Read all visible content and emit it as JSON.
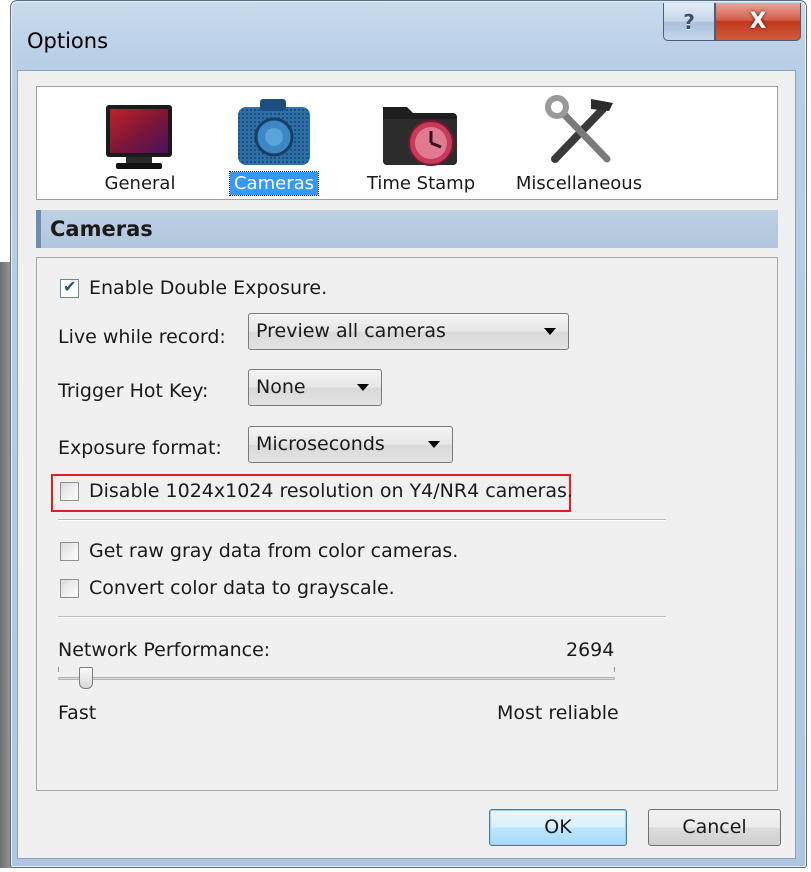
{
  "window": {
    "title": "Options",
    "help_glyph": "?",
    "close_glyph": "X"
  },
  "toolbar": {
    "items": [
      {
        "label": "General",
        "icon": "monitor-icon",
        "selected": false
      },
      {
        "label": "Cameras",
        "icon": "camera-icon",
        "selected": true
      },
      {
        "label": "Time Stamp",
        "icon": "clock-folder-icon",
        "selected": false
      },
      {
        "label": "Miscellaneous",
        "icon": "tools-icon",
        "selected": false
      }
    ]
  },
  "section": {
    "title": "Cameras"
  },
  "settings": {
    "double_exposure": {
      "label": "Enable Double Exposure.",
      "checked": true
    },
    "live_while_record": {
      "label": "Live while record:",
      "value": "Preview all cameras"
    },
    "trigger_hot_key": {
      "label": "Trigger Hot Key:",
      "value": "None"
    },
    "exposure_format": {
      "label": "Exposure format:",
      "value": "Microseconds"
    },
    "disable_1024": {
      "label": "Disable 1024x1024 resolution on Y4/NR4 cameras.",
      "checked": false
    },
    "raw_gray": {
      "label": "Get raw gray data from color cameras.",
      "checked": false
    },
    "convert_gray": {
      "label": "Convert color data to grayscale.",
      "checked": false
    },
    "network": {
      "label": "Network Performance:",
      "value": "2694",
      "min_label": "Fast",
      "max_label": "Most reliable",
      "level_fraction": 0.05
    }
  },
  "buttons": {
    "ok": "OK",
    "cancel": "Cancel"
  },
  "colors": {
    "highlight_box": "#e02020",
    "selection": "#3399ff",
    "header_band": "#b1c6dd"
  }
}
